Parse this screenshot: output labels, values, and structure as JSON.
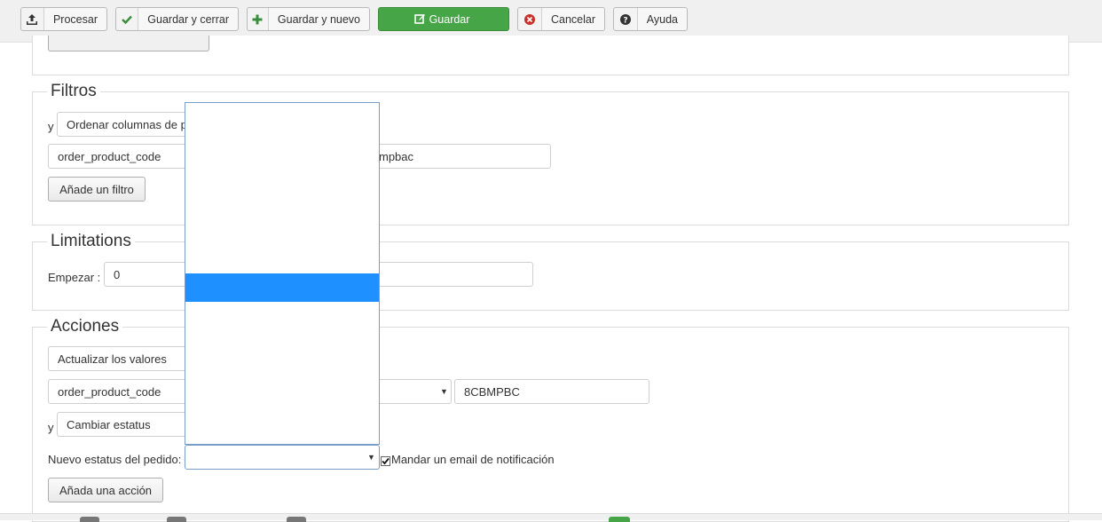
{
  "toolbar": {
    "buttons": [
      {
        "label": "Procesar",
        "icon": "upload-icon"
      },
      {
        "label": "Guardar y cerrar",
        "icon": "check-icon"
      },
      {
        "label": "Guardar y nuevo",
        "icon": "plus-icon"
      },
      {
        "label": "Guardar",
        "icon": "edit-icon"
      },
      {
        "label": "Cancelar",
        "icon": "cancel-circle-icon"
      },
      {
        "label": "Ayuda",
        "icon": "help-icon"
      }
    ]
  },
  "filtros": {
    "legend": "Filtros",
    "conjunction": "y",
    "sort_select": "Ordenar columnas de p",
    "field_select": "order_product_code",
    "value_partial": "mpbac",
    "add_button": "Añade un filtro"
  },
  "limitations": {
    "legend": "Limitations",
    "start_label": "Empezar :",
    "start_value": "0"
  },
  "acciones": {
    "legend": "Acciones",
    "action_select": "Actualizar los valores",
    "field_select": "order_product_code",
    "value": "8CBMPBC",
    "conjunction": "y",
    "status_action_select": "Cambiar estatus",
    "new_status_label": "Nuevo estatus del pedido:",
    "new_status_value": "",
    "notify_label": "Mandar un email de notificación",
    "notify_checked": true,
    "add_button": "Añada una acción"
  },
  "dropdown": {
    "selected_index": 6
  },
  "colors": {
    "primary": "#46a546",
    "selected_option": "#1e90ff"
  }
}
